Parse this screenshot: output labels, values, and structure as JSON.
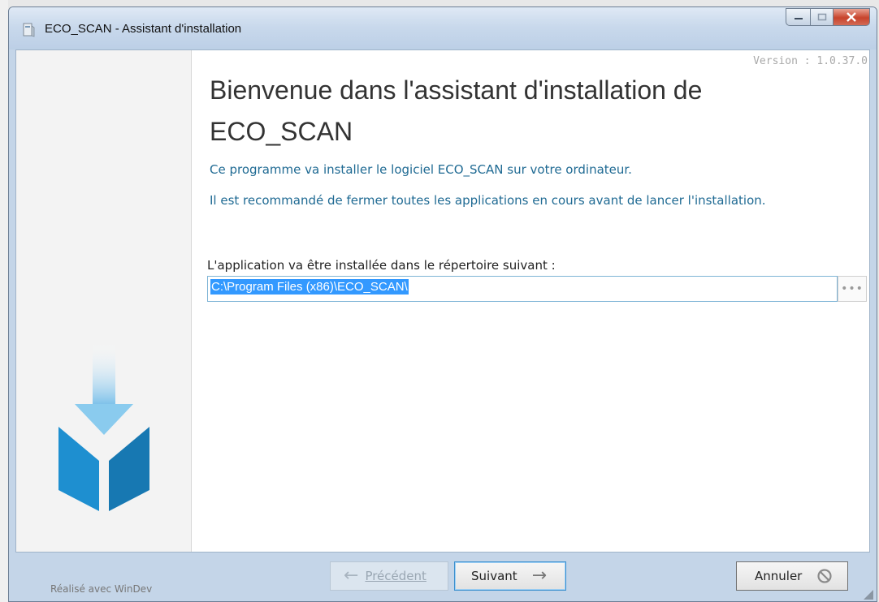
{
  "window": {
    "title": "ECO_SCAN - Assistant d'installation",
    "caption_buttons": [
      "minimize-icon",
      "maximize-icon",
      "close-icon"
    ]
  },
  "main": {
    "version": "Version : 1.0.37.0",
    "heading": "Bienvenue dans l'assistant d'installation de ECO_SCAN",
    "line1": "Ce programme va installer le logiciel ECO_SCAN sur votre ordinateur.",
    "line2": "Il est recommandé de fermer toutes les applications en cours avant de lancer l'installation.",
    "dir_label": "L'application va être installée dans le répertoire suivant :",
    "dir_value": "C:\\Program Files (x86)\\ECO_SCAN\\",
    "browse_label": "•••"
  },
  "footer": {
    "credit": "Réalisé avec WinDev",
    "prev_label": "Précédent",
    "next_label": "Suivant",
    "cancel_label": "Annuler"
  },
  "colors": {
    "accent_blue": "#1f6a93",
    "logo_blue": "#1e8fd0",
    "frame": "#c4d5e8"
  }
}
